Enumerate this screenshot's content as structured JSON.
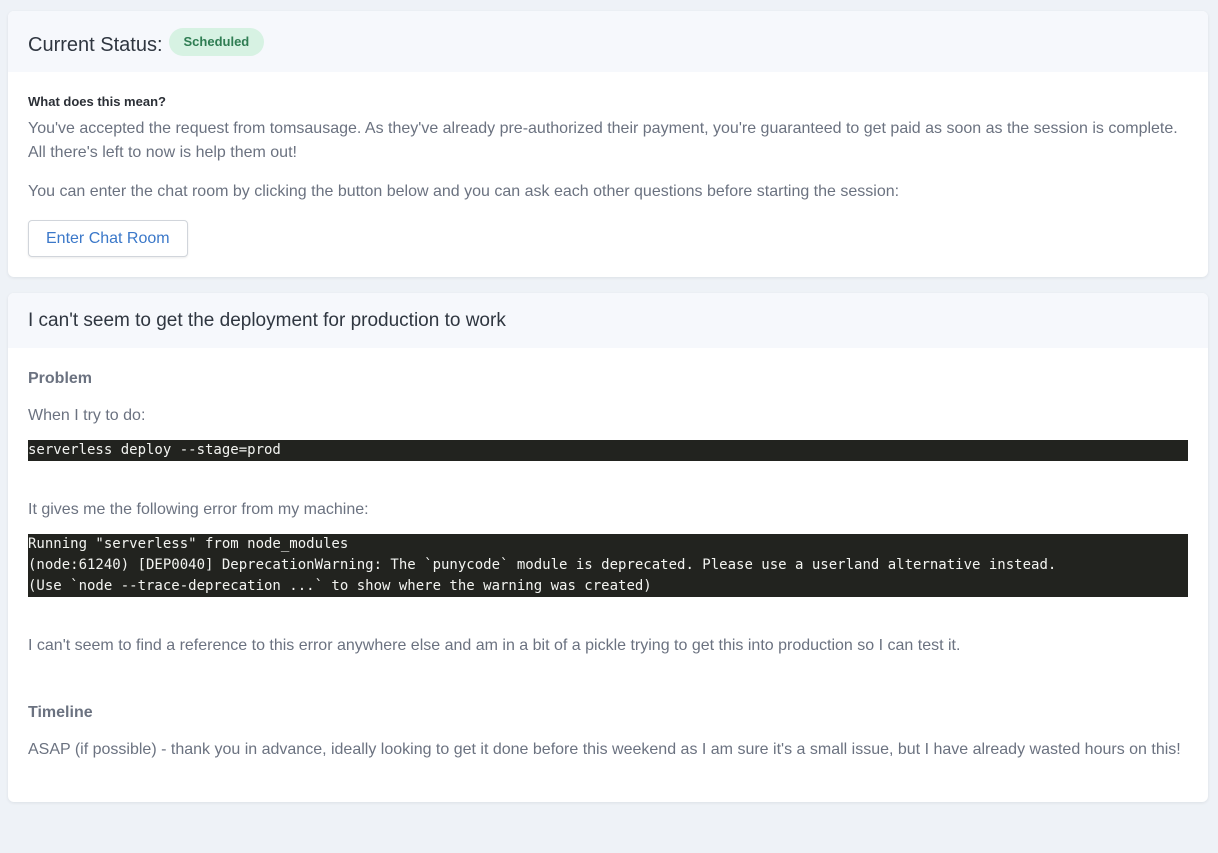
{
  "status": {
    "label": "Current Status:",
    "badge": "Scheduled",
    "badge_color": "#d7f2e3",
    "meaning_label": "What does this mean?",
    "paragraph_1": "You've accepted the request from tomsausage. As they've already pre-authorized their payment, you're guaranteed to get paid as soon as the session is complete. All there's left to now is help them out!",
    "paragraph_2": "You can enter the chat room by clicking the button below and you can ask each other questions before starting the session:",
    "chat_button": "Enter Chat Room"
  },
  "request": {
    "title": "I can't seem to get the deployment for production to work",
    "problem_heading": "Problem",
    "intro": "When I try to do:",
    "command": "serverless deploy --stage=prod",
    "error_intro": "It gives me the following error from my machine:",
    "error_output": "Running \"serverless\" from node_modules\n(node:61240) [DEP0040] DeprecationWarning: The `punycode` module is deprecated. Please use a userland alternative instead.\n(Use `node --trace-deprecation ...` to show where the warning was created)",
    "closing": "I can't seem to find a reference to this error anywhere else and am in a bit of a pickle trying to get this into production so I can test it.",
    "timeline_heading": "Timeline",
    "timeline_text": "ASAP (if possible) - thank you in advance, ideally looking to get it done before this weekend as I am sure it's a small issue, but I have already wasted hours on this!"
  }
}
